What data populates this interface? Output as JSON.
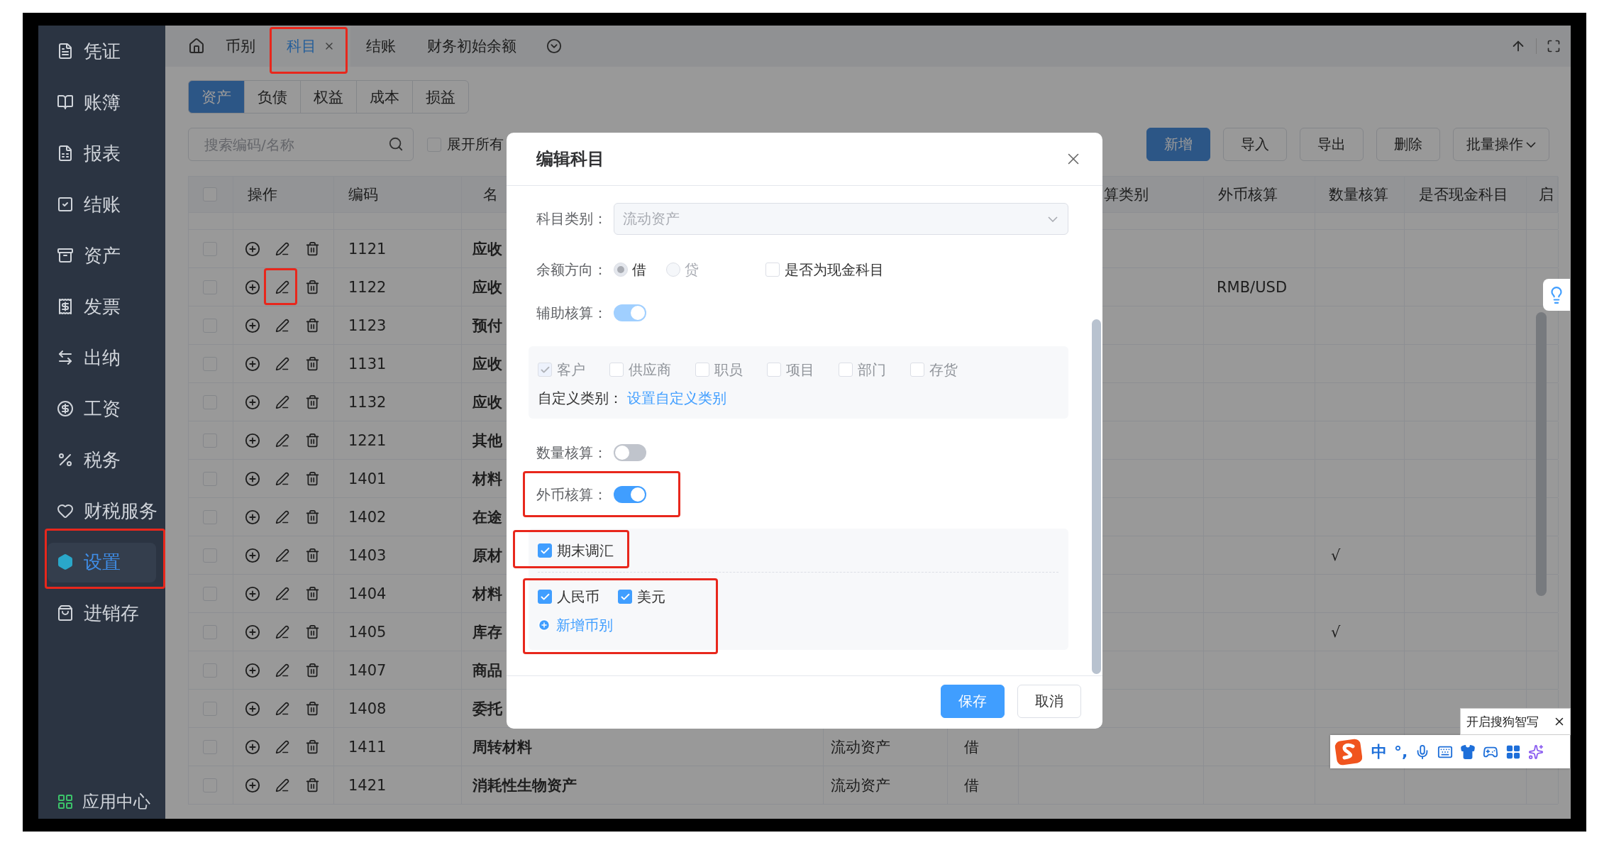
{
  "sidebar": {
    "items": [
      {
        "label": "凭证",
        "selected": false,
        "highlighted": false
      },
      {
        "label": "账簿",
        "selected": false,
        "highlighted": false
      },
      {
        "label": "报表",
        "selected": false,
        "highlighted": false
      },
      {
        "label": "结账",
        "selected": false,
        "highlighted": false
      },
      {
        "label": "资产",
        "selected": false,
        "highlighted": false
      },
      {
        "label": "发票",
        "selected": false,
        "highlighted": false
      },
      {
        "label": "出纳",
        "selected": false,
        "highlighted": false
      },
      {
        "label": "工资",
        "selected": false,
        "highlighted": false
      },
      {
        "label": "税务",
        "selected": false,
        "highlighted": false
      },
      {
        "label": "财税服务",
        "selected": false,
        "highlighted": false
      },
      {
        "label": "设置",
        "selected": true,
        "highlighted": true
      },
      {
        "label": "进销存",
        "selected": false,
        "highlighted": false
      }
    ],
    "footer": "应用中心"
  },
  "tabs": [
    {
      "label": "币别",
      "selected": false,
      "closable": false,
      "highlighted": false
    },
    {
      "label": "科目",
      "selected": true,
      "closable": true,
      "highlighted": true
    },
    {
      "label": "结账",
      "selected": false,
      "closable": false,
      "highlighted": false
    },
    {
      "label": "财务初始余额",
      "selected": false,
      "closable": false,
      "highlighted": false
    }
  ],
  "category_tabs": [
    {
      "label": "资产",
      "selected": true
    },
    {
      "label": "负债",
      "selected": false
    },
    {
      "label": "权益",
      "selected": false
    },
    {
      "label": "成本",
      "selected": false
    },
    {
      "label": "损益",
      "selected": false
    }
  ],
  "search": {
    "placeholder": "搜索编码/名称"
  },
  "expand_all": {
    "label": "展开所有",
    "checked": false
  },
  "actions": [
    {
      "label": "新增",
      "kind": "primary"
    },
    {
      "label": "导入",
      "kind": "default"
    },
    {
      "label": "导出",
      "kind": "default"
    },
    {
      "label": "删除",
      "kind": "default"
    },
    {
      "label": "批量操作",
      "kind": "dropdown"
    }
  ],
  "table": {
    "select_all": false,
    "columns": [
      "操作",
      "编码",
      "名",
      "算类别",
      "外币核算",
      "数量核算",
      "是否现金科目",
      "启"
    ],
    "rows": [
      {
        "code": "1121",
        "name": "应收",
        "checked": false,
        "edit_highlighted": false
      },
      {
        "code": "1122",
        "name": "应收",
        "fx": "RMB/USD",
        "checked": false,
        "edit_highlighted": true
      },
      {
        "code": "1123",
        "name": "预付",
        "checked": false,
        "edit_highlighted": false
      },
      {
        "code": "1131",
        "name": "应收",
        "checked": false,
        "edit_highlighted": false
      },
      {
        "code": "1132",
        "name": "应收",
        "checked": false,
        "edit_highlighted": false
      },
      {
        "code": "1221",
        "name": "其他",
        "checked": false,
        "edit_highlighted": false
      },
      {
        "code": "1401",
        "name": "材料",
        "checked": false,
        "edit_highlighted": false
      },
      {
        "code": "1402",
        "name": "在途",
        "checked": false,
        "edit_highlighted": false
      },
      {
        "code": "1403",
        "name": "原材",
        "qty": "√",
        "checked": false,
        "edit_highlighted": false
      },
      {
        "code": "1404",
        "name": "材料",
        "checked": false,
        "edit_highlighted": false
      },
      {
        "code": "1405",
        "name": "库存",
        "qty": "√",
        "checked": false,
        "edit_highlighted": false
      },
      {
        "code": "1407",
        "name": "商品",
        "checked": false,
        "edit_highlighted": false
      },
      {
        "code": "1408",
        "name": "委托",
        "checked": false,
        "edit_highlighted": false
      },
      {
        "code": "1411",
        "name": "周转材料",
        "category": "流动资产",
        "direction": "借",
        "checked": false,
        "edit_highlighted": false
      },
      {
        "code": "1421",
        "name": "消耗性生物资产",
        "category": "流动资产",
        "direction": "借",
        "checked": false,
        "edit_highlighted": false
      }
    ]
  },
  "dialog": {
    "title": "编辑科目",
    "category": {
      "label": "科目类别：",
      "value": "流动资产",
      "disabled": true
    },
    "direction": {
      "label": "余额方向：",
      "options": [
        {
          "label": "借",
          "selected": true
        },
        {
          "label": "贷",
          "selected": false
        }
      ],
      "cash": {
        "label": "是否为现金科目",
        "checked": false
      }
    },
    "auxiliary": {
      "label": "辅助核算：",
      "on": true,
      "disabled": true,
      "items_disabled": true,
      "items": [
        {
          "label": "客户",
          "checked": true
        },
        {
          "label": "供应商",
          "checked": false
        },
        {
          "label": "职员",
          "checked": false
        },
        {
          "label": "项目",
          "checked": false
        },
        {
          "label": "部门",
          "checked": false
        },
        {
          "label": "存货",
          "checked": false
        }
      ],
      "custom_label": "自定义类别：",
      "custom_link": "设置自定义类别"
    },
    "quantity": {
      "label": "数量核算：",
      "on": false
    },
    "foreign": {
      "label": "外币核算：",
      "on": true,
      "highlighted": true,
      "revaluation": {
        "label": "期末调汇",
        "checked": true,
        "highlighted": true
      },
      "currencies": [
        {
          "label": "人民币",
          "checked": true
        },
        {
          "label": "美元",
          "checked": true
        }
      ],
      "currencies_highlighted": true,
      "add_currency": "新增币别"
    },
    "buttons": [
      {
        "label": "保存",
        "kind": "primary"
      },
      {
        "label": "取消",
        "kind": "default"
      }
    ]
  },
  "ime": {
    "tip": "开启搜狗智写",
    "mode": "中",
    "punct": "°,"
  }
}
